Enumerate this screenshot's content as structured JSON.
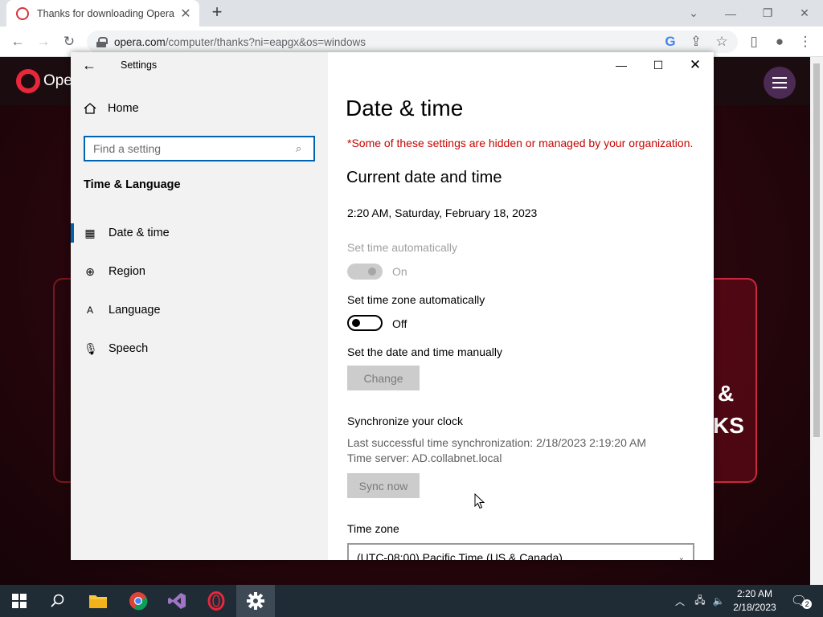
{
  "browser": {
    "tab_title": "Thanks for downloading Opera",
    "new_tab": "+",
    "url_host": "opera.com",
    "url_path": "/computer/thanks?ni=eapgx&os=windows"
  },
  "opera_page": {
    "logo_text": "Ope",
    "big_text_1": "&",
    "big_text_2": "KS"
  },
  "settings": {
    "app_title": "Settings",
    "nav": {
      "home": "Home",
      "search_placeholder": "Find a setting",
      "section": "Time & Language",
      "items": [
        {
          "label": "Date & time",
          "icon": "calendar-clock-icon",
          "active": true
        },
        {
          "label": "Region",
          "icon": "globe-icon",
          "active": false
        },
        {
          "label": "Language",
          "icon": "language-icon",
          "active": false
        },
        {
          "label": "Speech",
          "icon": "microphone-icon",
          "active": false
        }
      ]
    },
    "content": {
      "title": "Date & time",
      "warning": "*Some of these settings are hidden or managed by your organization.",
      "current_heading": "Current date and time",
      "current_value": "2:20 AM, Saturday, February 18, 2023",
      "set_time_auto_label": "Set time automatically",
      "set_time_auto_state": "On",
      "set_tz_auto_label": "Set time zone automatically",
      "set_tz_auto_state": "Off",
      "manual_label": "Set the date and time manually",
      "change_button": "Change",
      "sync_heading": "Synchronize your clock",
      "last_sync": "Last successful time synchronization: 2/18/2023 2:19:20 AM",
      "time_server": "Time server: AD.collabnet.local",
      "sync_button": "Sync now",
      "timezone_label": "Time zone",
      "timezone_value": "(UTC-08:00) Pacific Time (US & Canada)"
    }
  },
  "taskbar": {
    "time": "2:20 AM",
    "date": "2/18/2023",
    "notifications": "2"
  },
  "colors": {
    "accent": "#0063b1",
    "warning": "#c50500",
    "opera_red": "#e8273b"
  }
}
